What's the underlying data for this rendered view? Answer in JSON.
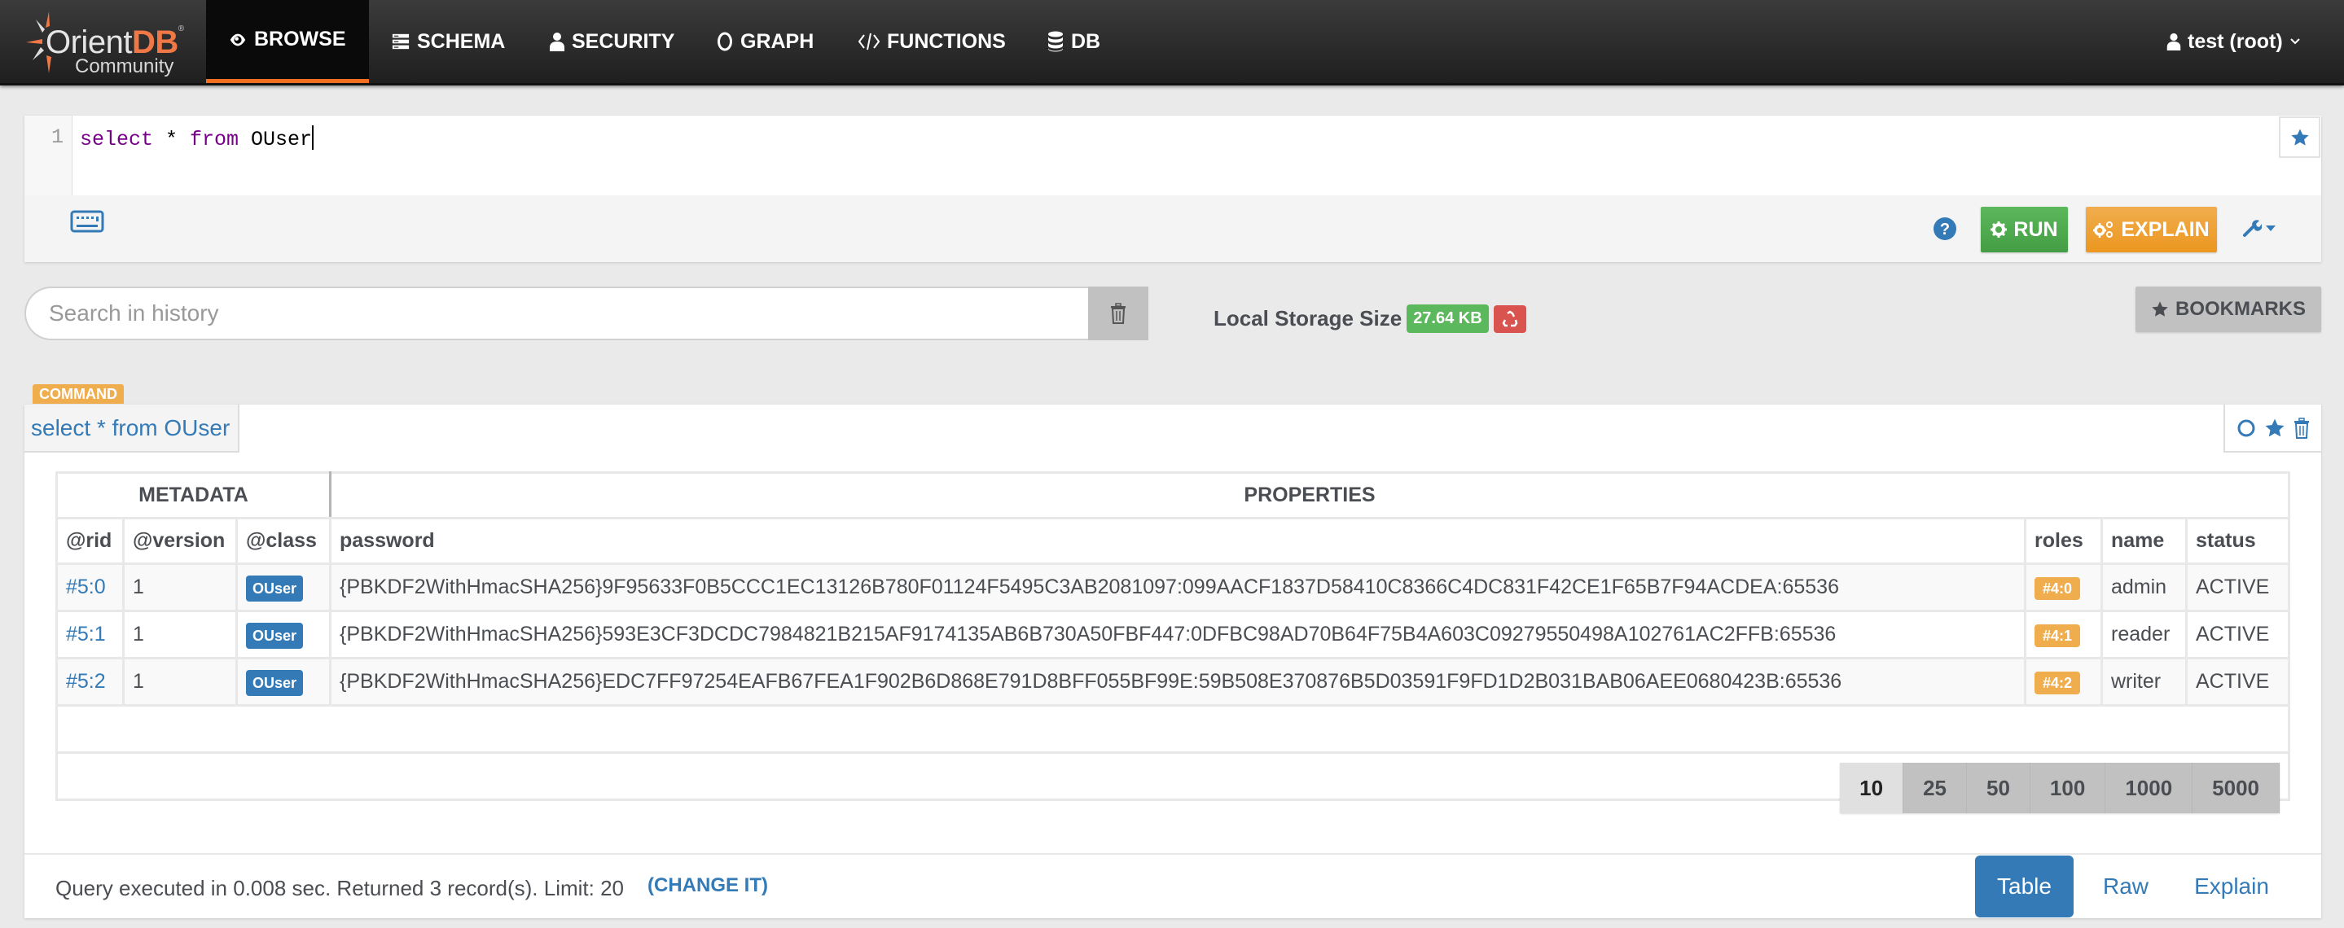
{
  "navbar": {
    "logo": {
      "brand_prefix": "Orient",
      "brand_suffix": "DB",
      "subtitle": "Community"
    },
    "items": [
      {
        "label": "BROWSE",
        "icon": "eye-icon",
        "active": true
      },
      {
        "label": "SCHEMA",
        "icon": "schema-icon",
        "active": false
      },
      {
        "label": "SECURITY",
        "icon": "user-icon",
        "active": false
      },
      {
        "label": "GRAPH",
        "icon": "circle-icon",
        "active": false
      },
      {
        "label": "FUNCTIONS",
        "icon": "code-icon",
        "active": false
      },
      {
        "label": "DB",
        "icon": "database-icon",
        "active": false
      }
    ],
    "user": {
      "label": "test (root)",
      "icon": "user-icon"
    }
  },
  "editor": {
    "line_number": "1",
    "query_keyword1": "select",
    "query_star": " * ",
    "query_keyword2": "from",
    "query_target": " OUser",
    "run_label": "RUN",
    "explain_label": "EXPLAIN"
  },
  "history": {
    "placeholder": "Search in history",
    "value": ""
  },
  "storage": {
    "label": "Local Storage Size",
    "size": "27.64 KB"
  },
  "bookmarks_label": "BOOKMARKS",
  "result": {
    "badge": "COMMAND",
    "query": "select * from OUser",
    "group_headers": {
      "metadata": "METADATA",
      "properties": "PROPERTIES"
    },
    "columns": [
      "@rid",
      "@version",
      "@class",
      "password",
      "roles",
      "name",
      "status"
    ],
    "rows": [
      {
        "rid": "#5:0",
        "version": "1",
        "class": "OUser",
        "password": "{PBKDF2WithHmacSHA256}9F95633F0B5CCC1EC13126B780F01124F5495C3AB2081097:099AACF1837D58410C8366C4DC831F42CE1F65B7F94ACDEA:65536",
        "roles": "#4:0",
        "name": "admin",
        "status": "ACTIVE"
      },
      {
        "rid": "#5:1",
        "version": "1",
        "class": "OUser",
        "password": "{PBKDF2WithHmacSHA256}593E3CF3DCDC7984821B215AF9174135AB6B730A50FBF447:0DFBC98AD70B64F75B4A603C09279550498A102761AC2FFB:65536",
        "roles": "#4:1",
        "name": "reader",
        "status": "ACTIVE"
      },
      {
        "rid": "#5:2",
        "version": "1",
        "class": "OUser",
        "password": "{PBKDF2WithHmacSHA256}EDC7FF97254EAFB67FEA1F902B6D868E791D8BFF055BF99E:59B508E370876B5D03591F9FD1D2B031BAB06AEE0680423B:65536",
        "roles": "#4:2",
        "name": "writer",
        "status": "ACTIVE"
      }
    ],
    "page_sizes": [
      "10",
      "25",
      "50",
      "100",
      "1000",
      "5000"
    ],
    "selected_page_size": "10",
    "status": "Query executed in 0.008 sec. Returned 3 record(s). Limit: 20",
    "change_link": "(CHANGE IT)",
    "views": [
      {
        "label": "Table",
        "active": true
      },
      {
        "label": "Raw",
        "active": false
      },
      {
        "label": "Explain",
        "active": false
      }
    ]
  },
  "colors": {
    "accent_orange": "#f36f20",
    "primary_blue": "#337ab7",
    "success_green": "#5cb85c",
    "warning_orange": "#f0ad4e",
    "danger_red": "#d9534f"
  }
}
